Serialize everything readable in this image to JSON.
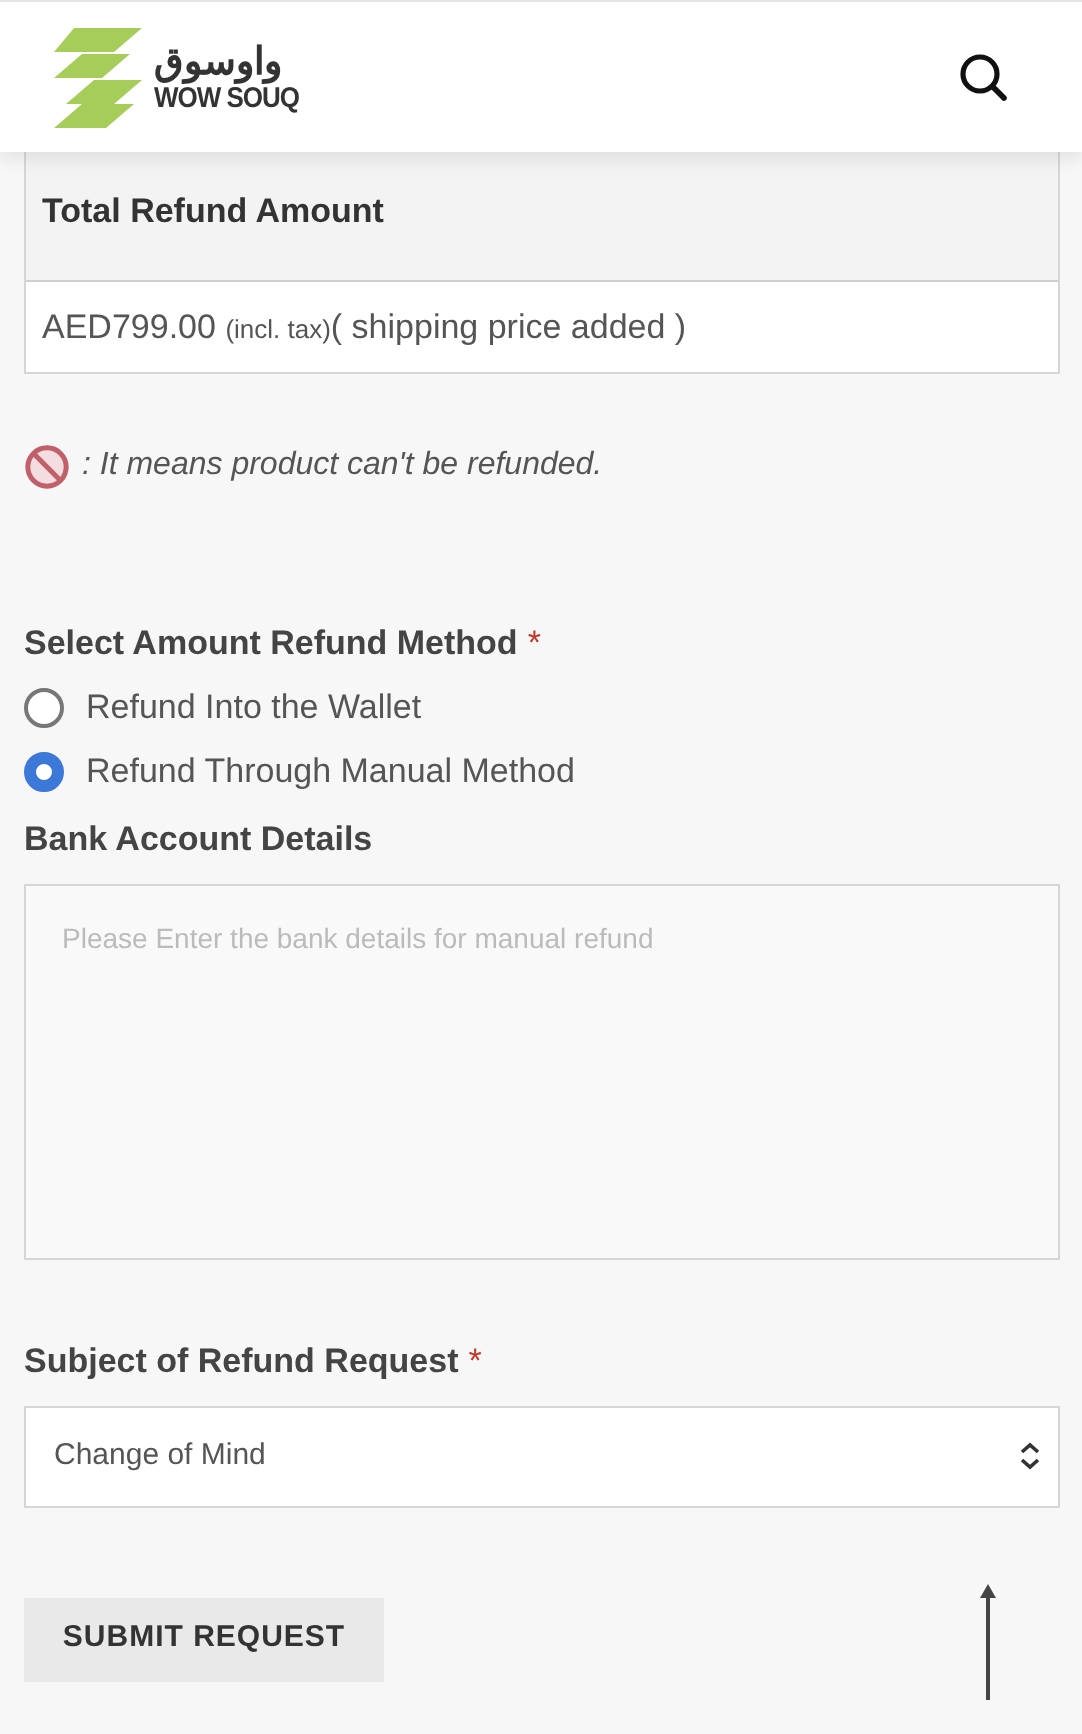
{
  "header": {
    "logo_arabic": "واوسوق",
    "logo_latin": "WOW SOUQ"
  },
  "refund_table": {
    "heading": "Total Refund Amount",
    "amount": "AED799.00",
    "tax_note": "(incl. tax)",
    "shipping_note": "( shipping price added )"
  },
  "legend": {
    "text": ": It means product can't be refunded."
  },
  "refund_method": {
    "label": "Select Amount Refund Method",
    "required_mark": "*",
    "options": [
      {
        "label": "Refund Into the Wallet",
        "selected": false
      },
      {
        "label": "Refund Through Manual Method",
        "selected": true
      }
    ]
  },
  "bank_details": {
    "label": "Bank Account Details",
    "placeholder": "Please Enter the bank details for manual refund"
  },
  "subject": {
    "label": "Subject of Refund Request",
    "required_mark": "*",
    "value": "Change of Mind"
  },
  "submit_button": "SUBMIT REQUEST"
}
